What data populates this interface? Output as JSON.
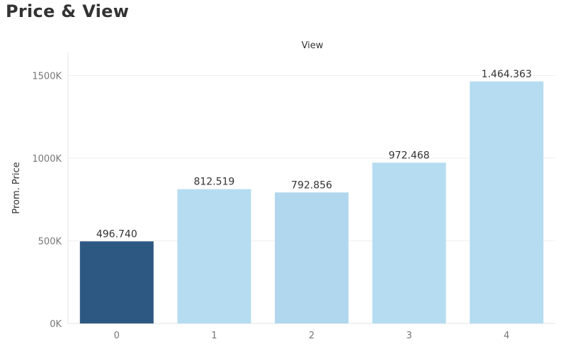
{
  "page": {
    "title": "Price & View"
  },
  "chart_data": {
    "type": "bar",
    "title": "Price & View",
    "column_header": "View",
    "xlabel": "",
    "ylabel": "Prom. Price",
    "categories": [
      "0",
      "1",
      "2",
      "3",
      "4"
    ],
    "values": [
      496740,
      812519,
      792856,
      972468,
      1464363
    ],
    "value_labels": [
      "496.740",
      "812.519",
      "792.856",
      "972.468",
      "1.464.363"
    ],
    "ylim": [
      0,
      1630000
    ],
    "yticks": [
      0,
      500000,
      1000000,
      1500000
    ],
    "ytick_labels": [
      "0K",
      "500K",
      "1000K",
      "1500K"
    ],
    "colors": [
      "#2d5882",
      "#b5dcf1",
      "#b1d7ee",
      "#b5dcf1",
      "#b5dcf1"
    ],
    "grid": true,
    "legend": "none"
  }
}
